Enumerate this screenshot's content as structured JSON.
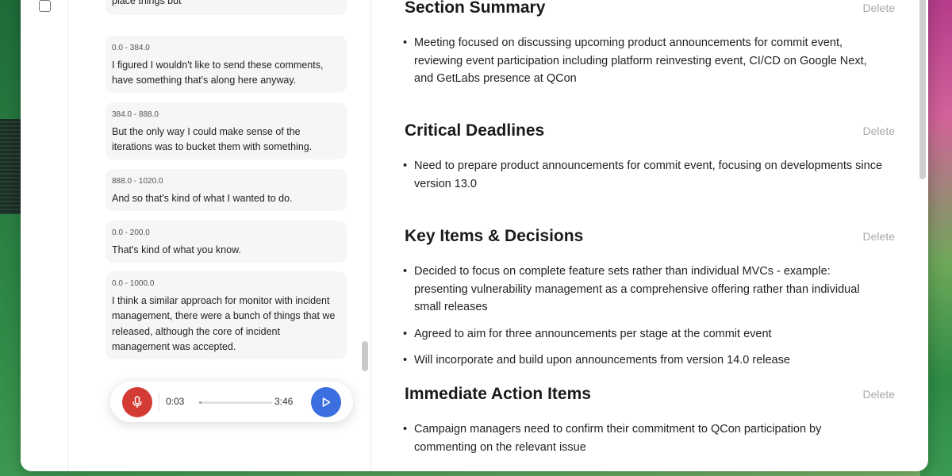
{
  "transcript": {
    "segments": [
      {
        "time": "",
        "text": "place things but"
      },
      {
        "time": "0.0 - 384.0",
        "text": "I figured I wouldn't like to send these comments, have something that's along here anyway."
      },
      {
        "time": "384.0 - 888.0",
        "text": "But the only way I could make sense of the iterations was to bucket them with something."
      },
      {
        "time": "888.0 - 1020.0",
        "text": "And so that's kind of what I wanted to do."
      },
      {
        "time": "0.0 - 200.0",
        "text": "That's kind of what you know."
      },
      {
        "time": "0.0 - 1000.0",
        "text": "I think a similar approach for monitor with incident management, there were a bunch of things that we released, although the core of incident management was accepted."
      }
    ]
  },
  "player": {
    "current_time": "0:03",
    "total_time": "3:46",
    "progress": 0.03,
    "mic_icon": "microphone-icon",
    "play_icon": "play-icon",
    "mic_color": "#d43b35",
    "play_color": "#3b6fe0"
  },
  "summary": {
    "delete_label": "Delete",
    "sections": [
      {
        "title": "Section Summary",
        "items": [
          "Meeting focused on discussing upcoming product announcements for commit event, reviewing event participation including platform reinvesting event, CI/CD on Google Next, and GetLabs presence at QCon"
        ]
      },
      {
        "title": "Critical Deadlines",
        "items": [
          "Need to prepare product announcements for commit event, focusing on developments since version 13.0"
        ]
      },
      {
        "title": "Key Items & Decisions",
        "items": [
          "Decided to focus on complete feature sets rather than individual MVCs - example: presenting vulnerability management as a comprehensive offering rather than individual small releases",
          "Agreed to aim for three announcements per stage at the commit event",
          "Will incorporate and build upon announcements from version 14.0 release"
        ]
      },
      {
        "title": "Immediate Action Items",
        "items": [
          "Campaign managers need to confirm their commitment to QCon participation by commenting on the relevant issue"
        ]
      }
    ]
  }
}
